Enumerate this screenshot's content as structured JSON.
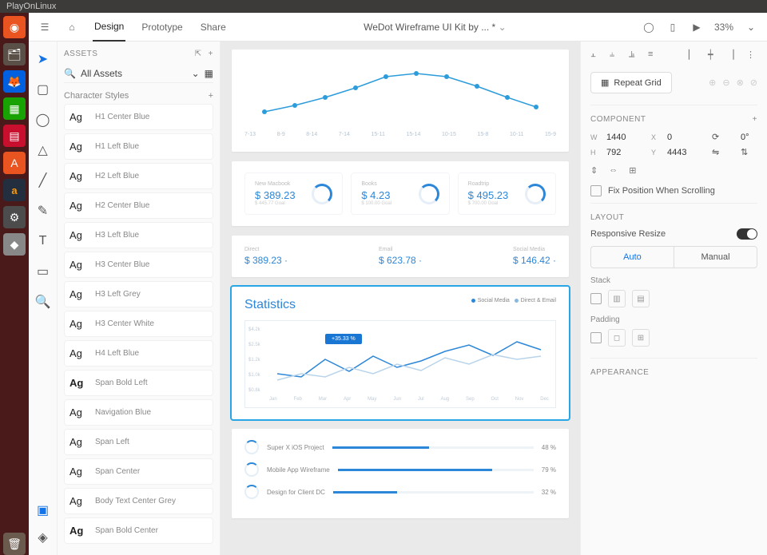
{
  "titlebar": "PlayOnLinux",
  "topbar": {
    "tabs": [
      "Design",
      "Prototype",
      "Share"
    ],
    "active_tab": 0,
    "doc_title": "WeDot Wireframe UI Kit by ... *",
    "zoom": "33%"
  },
  "tools": [
    "select",
    "rect",
    "ellipse",
    "polygon",
    "line",
    "pen",
    "text",
    "artboard",
    "zoom"
  ],
  "assets": {
    "header": "ASSETS",
    "search_label": "All Assets",
    "styles_header": "Character Styles",
    "styles": [
      {
        "name": "H1 Center Blue",
        "bold": false
      },
      {
        "name": "H1 Left Blue",
        "bold": false
      },
      {
        "name": "H2 Left Blue",
        "bold": false
      },
      {
        "name": "H2 Center Blue",
        "bold": false
      },
      {
        "name": "H3 Left Blue",
        "bold": false
      },
      {
        "name": "H3 Center Blue",
        "bold": false
      },
      {
        "name": "H3 Left Grey",
        "bold": false
      },
      {
        "name": "H3 Center White",
        "bold": false
      },
      {
        "name": "H4 Left Blue",
        "bold": false
      },
      {
        "name": "Span Bold Left",
        "bold": true
      },
      {
        "name": "Navigation Blue",
        "bold": false
      },
      {
        "name": "Span Left",
        "bold": false
      },
      {
        "name": "Span Center",
        "bold": false
      },
      {
        "name": "Body Text Center Grey",
        "bold": false
      },
      {
        "name": "Span Bold Center",
        "bold": true
      }
    ]
  },
  "chart_data": [
    {
      "type": "line",
      "artboard": "curve",
      "categories": [
        "7-13",
        "8-9",
        "8-14",
        "7-14",
        "15-11",
        "15-14",
        "10-15",
        "15-8",
        "10-11",
        "15-9"
      ],
      "values": [
        20,
        30,
        42,
        58,
        75,
        80,
        75,
        60,
        42,
        28
      ],
      "ylim": [
        0,
        100
      ]
    },
    {
      "type": "line",
      "artboard": "statistics",
      "title": "Statistics",
      "series": [
        {
          "name": "Social Media",
          "values": [
            25,
            20,
            50,
            30,
            55,
            35,
            45,
            60,
            70,
            50,
            75,
            60
          ]
        },
        {
          "name": "Direct & Email",
          "values": [
            15,
            25,
            20,
            35,
            25,
            40,
            30,
            50,
            40,
            55,
            45,
            50
          ]
        }
      ],
      "categories": [
        "Jan",
        "Feb",
        "Mar",
        "Apr",
        "May",
        "Jun",
        "Jul",
        "Aug",
        "Sep",
        "Oct",
        "Nov",
        "Dec"
      ],
      "ylabels": [
        "$4.2k",
        "$2.5k",
        "$1.2k",
        "$1.0k",
        "$0.8k"
      ],
      "tooltip": "+35.33 %"
    }
  ],
  "kpis": [
    {
      "label": "New Macbook",
      "value": "$ 389.23",
      "sub": "$ 445.77 Goal"
    },
    {
      "label": "Books",
      "value": "$ 4.23",
      "sub": "$ 100.00 Goal"
    },
    {
      "label": "Roadtrip",
      "value": "$ 495.23",
      "sub": "$ 700.00 Goal"
    }
  ],
  "stats_small": [
    {
      "label": "Direct",
      "value": "$ 389.23 ·"
    },
    {
      "label": "Email",
      "value": "$ 623.78 ·"
    },
    {
      "label": "Social Media",
      "value": "$ 146.42 ·"
    }
  ],
  "stats_legend": [
    "Social Media",
    "Direct & Email"
  ],
  "projects": [
    {
      "name": "Super X iOS Project",
      "pct": 48
    },
    {
      "name": "Mobile App Wireframe",
      "pct": 79
    },
    {
      "name": "Design for Client DC",
      "pct": 32
    }
  ],
  "inspector": {
    "repeat_grid": "Repeat Grid",
    "component_hdr": "COMPONENT",
    "transform": {
      "w": "1440",
      "h": "792",
      "x": "0",
      "y": "4443",
      "rot": "0°"
    },
    "fix_position": "Fix Position When Scrolling",
    "layout_hdr": "LAYOUT",
    "responsive": "Responsive Resize",
    "seg_auto": "Auto",
    "seg_manual": "Manual",
    "stack_lbl": "Stack",
    "padding_lbl": "Padding",
    "appearance_hdr": "APPEARANCE"
  }
}
